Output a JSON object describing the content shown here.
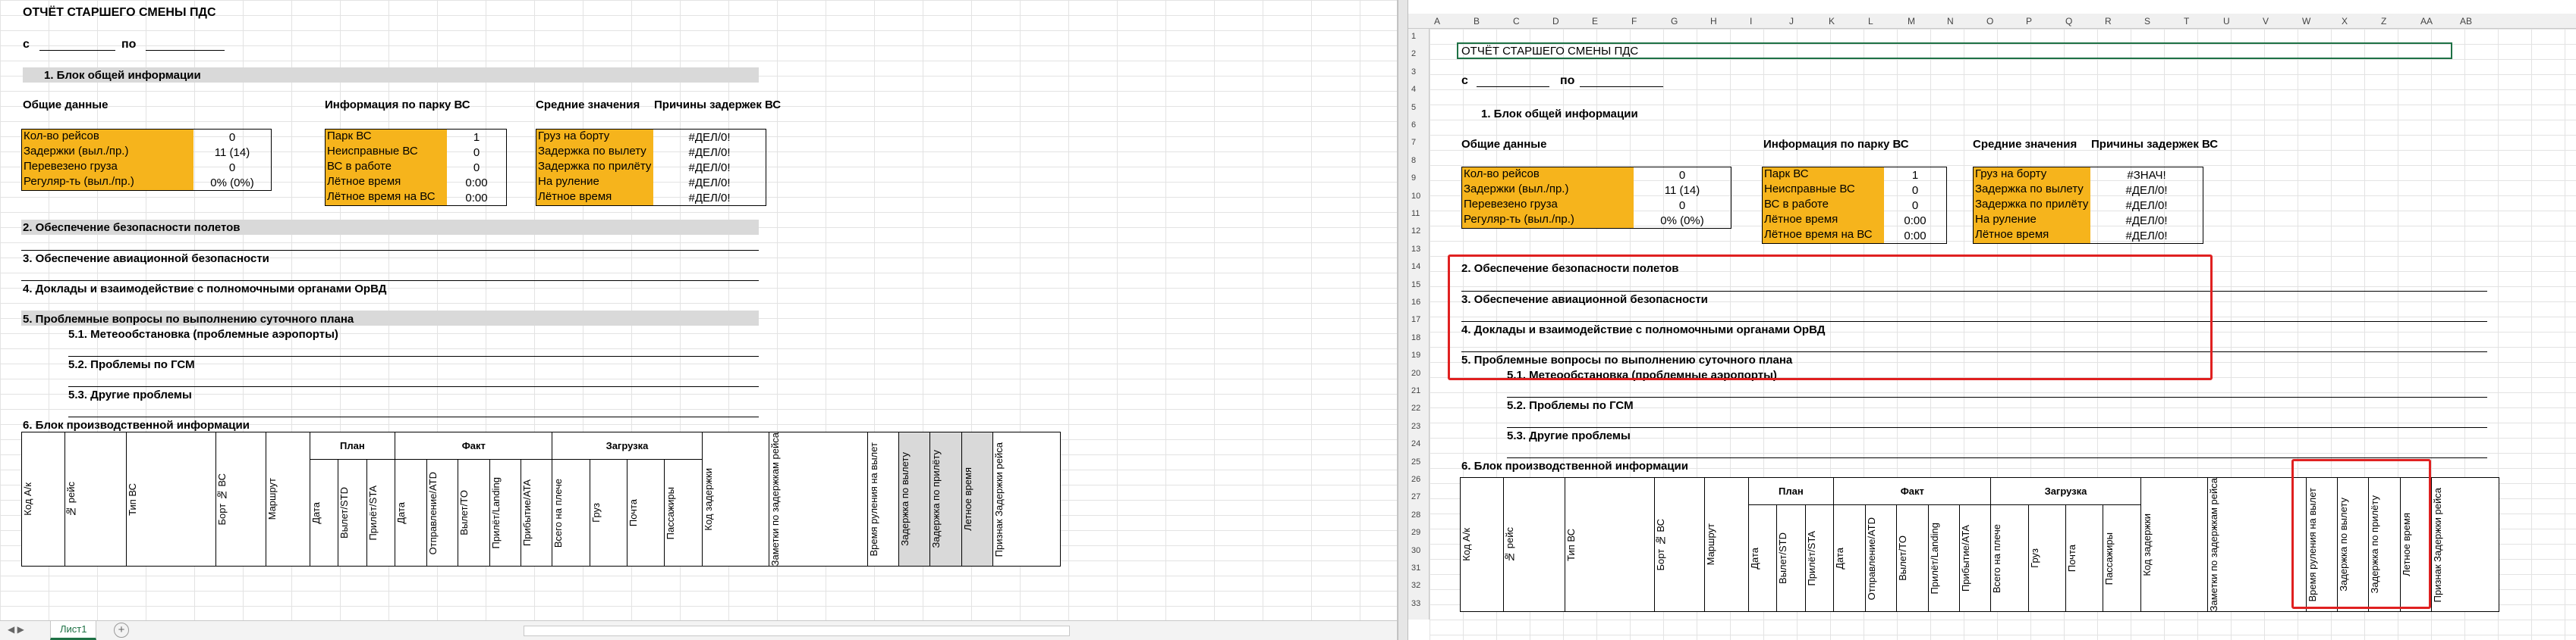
{
  "report_title": "ОТЧЁТ СТАРШЕГО СМЕНЫ ПДС",
  "date_from_label": "с",
  "date_to_label": "по",
  "section1_title": "1. Блок общей информации",
  "general_title": "Общие данные",
  "fleet_title": "Информация по парку ВС",
  "averages_title": "Средние значения",
  "delay_reasons_title": "Причины задержек ВС",
  "general_rows": [
    {
      "label": "Кол-во рейсов",
      "value": "0"
    },
    {
      "label": "Задержки (выл./пр.)",
      "value": "11 (14)"
    },
    {
      "label": "Перевезено груза",
      "value": "0"
    },
    {
      "label": "Регуляр-ть (выл./пр.)",
      "value": "0% (0%)"
    }
  ],
  "fleet_rows": [
    {
      "label": "Парк ВС",
      "value": "1"
    },
    {
      "label": "Неисправные ВС",
      "value": "0"
    },
    {
      "label": "ВС в работе",
      "value": "0"
    },
    {
      "label": "Лётное время",
      "value": "0:00"
    },
    {
      "label": "Лётное время на ВС",
      "value": "0:00"
    }
  ],
  "averages_rows_left": [
    {
      "label": "Груз на борту",
      "value": "#ДЕЛ/0!"
    },
    {
      "label": "Задержка по вылету",
      "value": "#ДЕЛ/0!"
    },
    {
      "label": "Задержка по прилёту",
      "value": "#ДЕЛ/0!"
    },
    {
      "label": "На руление",
      "value": "#ДЕЛ/0!"
    },
    {
      "label": "Лётное время",
      "value": "#ДЕЛ/0!"
    }
  ],
  "averages_rows_right": [
    {
      "label": "Груз на борту",
      "value": "#ЗНАЧ!"
    },
    {
      "label": "Задержка по вылету",
      "value": "#ДЕЛ/0!"
    },
    {
      "label": "Задержка по прилёту",
      "value": "#ДЕЛ/0!"
    },
    {
      "label": "На руление",
      "value": "#ДЕЛ/0!"
    },
    {
      "label": "Лётное время",
      "value": "#ДЕЛ/0!"
    }
  ],
  "section2_title": "2. Обеспечение безопасности полетов",
  "section3_title": "3. Обеспечение авиационной безопасности",
  "section4_title": "4. Доклады и взаимодействие с полномочными органами ОрВД",
  "section5_title": "5. Проблемные вопросы по выполнению суточного плана",
  "sub51": "5.1. Метеообстановка (проблемные аэропорты)",
  "sub52": "5.2. Проблемы по ГСМ",
  "sub53": "5.3. Другие проблемы",
  "section6_title": "6. Блок производственной информации",
  "table": {
    "col_code": "Код А/к",
    "col_flight": "№ рейс",
    "col_type": "Тип ВС",
    "col_board": "Борт № ВС",
    "col_route": "Маршрут",
    "grp_plan": "План",
    "grp_fact": "Факт",
    "grp_load": "Загрузка",
    "plan_date": "Дата",
    "plan_std": "Вылет/STD",
    "plan_sta": "Прилёт/STA",
    "fact_date": "Дата",
    "fact_atd": "Отправление/ATD",
    "fact_to": "Вылет/TO",
    "fact_landing": "Прилёт/Landing",
    "fact_ata": "Прибытие/ATA",
    "load_total": "Всего на плече",
    "load_cargo": "Груз",
    "load_mail": "Почта",
    "load_pax": "Пассажиры",
    "col_delay_code": "Код задержки",
    "col_notes": "Заметки по задержкам рейса",
    "col_taxi": "Время руления на вылет",
    "col_dep_delay": "Задержка по вылету",
    "col_arr_delay": "Задержка по прилёту",
    "col_flight_time": "Летное время",
    "col_delay_flag": "Признак Задержки рейса"
  },
  "sheet_tab": "Лист1",
  "add_sheet": "+",
  "columns_right": [
    "A",
    "B",
    "C",
    "D",
    "E",
    "F",
    "G",
    "H",
    "I",
    "J",
    "K",
    "L",
    "M",
    "N",
    "O",
    "P",
    "Q",
    "R",
    "S",
    "T",
    "U",
    "V",
    "W",
    "X",
    "Z",
    "AA",
    "AB"
  ],
  "rows_right": [
    "1",
    "2",
    "3",
    "4",
    "5",
    "6",
    "7",
    "8",
    "9",
    "10",
    "11",
    "12",
    "13",
    "14",
    "15",
    "16",
    "17",
    "18",
    "19",
    "20",
    "21",
    "22",
    "23",
    "24",
    "25",
    "26",
    "27",
    "28",
    "29",
    "30",
    "31",
    "32",
    "33"
  ],
  "colors": {
    "accent": "#f6b41c",
    "section_band": "#d9d9d9",
    "highlight": "#e02020"
  }
}
